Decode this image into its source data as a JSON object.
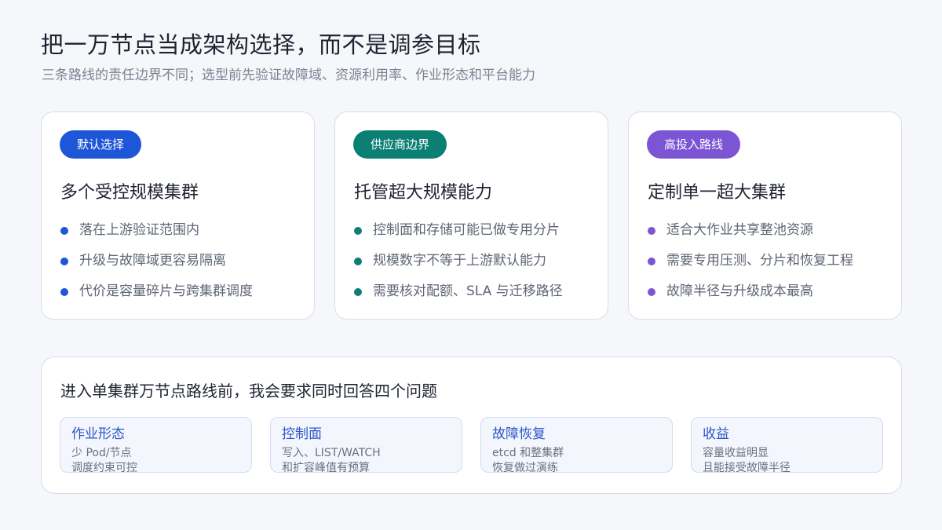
{
  "header": {
    "title": "把一万节点当成架构选择，而不是调参目标",
    "subtitle": "三条路线的责任边界不同；选型前先验证故障域、资源利用率、作业形态和平台能力"
  },
  "cards": [
    {
      "badge": "默认选择",
      "accent": "#1d56d6",
      "title": "多个受控规模集群",
      "bullets": [
        "落在上游验证范围内",
        "升级与故障域更容易隔离",
        "代价是容量碎片与跨集群调度"
      ]
    },
    {
      "badge": "供应商边界",
      "accent": "#0b7f73",
      "title": "托管超大规模能力",
      "bullets": [
        "控制面和存储可能已做专用分片",
        "规模数字不等于上游默认能力",
        "需要核对配额、SLA 与迁移路径"
      ]
    },
    {
      "badge": "高投入路线",
      "accent": "#7b55d3",
      "title": "定制单一超大集群",
      "bullets": [
        "适合大作业共享整池资源",
        "需要专用压测、分片和恢复工程",
        "故障半径与升级成本最高"
      ]
    }
  ],
  "panel": {
    "title": "进入单集群万节点路线前，我会要求同时回答四个问题",
    "questions": [
      {
        "title": "作业形态",
        "line1": "少 Pod/节点",
        "line2": "调度约束可控"
      },
      {
        "title": "控制面",
        "line1": "写入、LIST/WATCH",
        "line2": "和扩容峰值有预算"
      },
      {
        "title": "故障恢复",
        "line1": "etcd 和整集群",
        "line2": "恢复做过演练"
      },
      {
        "title": "收益",
        "line1": "容量收益明显",
        "line2": "且能接受故障半径"
      }
    ]
  }
}
